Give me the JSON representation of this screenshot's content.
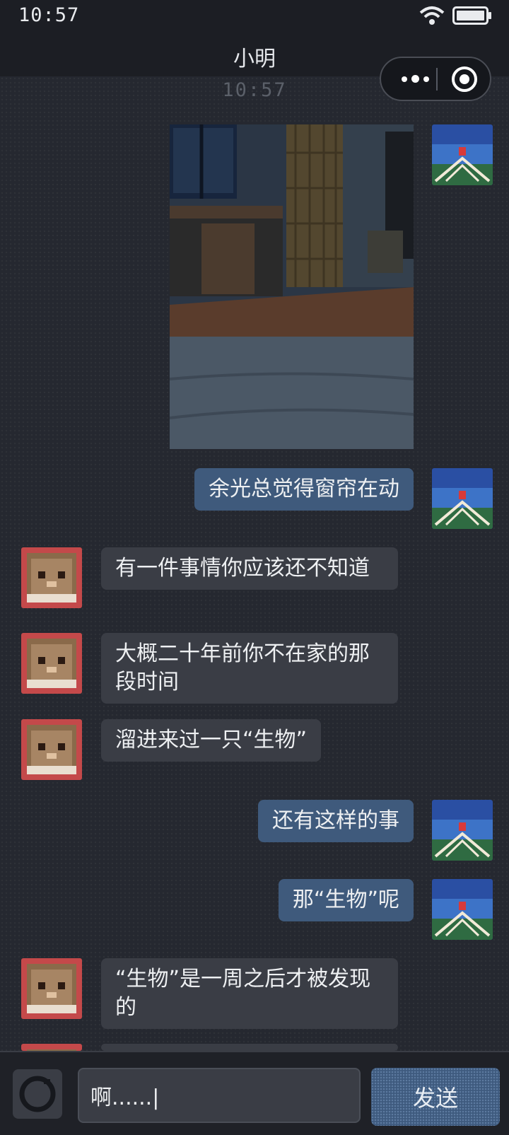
{
  "status_bar": {
    "time": "10:57"
  },
  "header": {
    "title": "小明"
  },
  "chat": {
    "timestamp": "10:57",
    "messages": [
      {
        "sender": "me",
        "type": "image"
      },
      {
        "sender": "me",
        "text": "余光总觉得窗帘在动"
      },
      {
        "sender": "other",
        "text": "有一件事情你应该还不知道"
      },
      {
        "sender": "other",
        "text": "大概二十年前你不在家的那段时间"
      },
      {
        "sender": "other",
        "text": "溜进来过一只“生物”"
      },
      {
        "sender": "me",
        "text": "还有这样的事"
      },
      {
        "sender": "me",
        "text": "那“生物”呢"
      },
      {
        "sender": "other",
        "text": "“生物”是一周之后才被发现的"
      }
    ]
  },
  "input": {
    "value": "啊......|"
  },
  "send_button": {
    "label": "发送"
  },
  "colors": {
    "me_bubble": "#3f5a7c",
    "other_bubble": "#3a3d45",
    "background": "#252830"
  },
  "icons": [
    "wifi-icon",
    "battery-icon",
    "more-icon",
    "close-icon",
    "camera-icon"
  ]
}
